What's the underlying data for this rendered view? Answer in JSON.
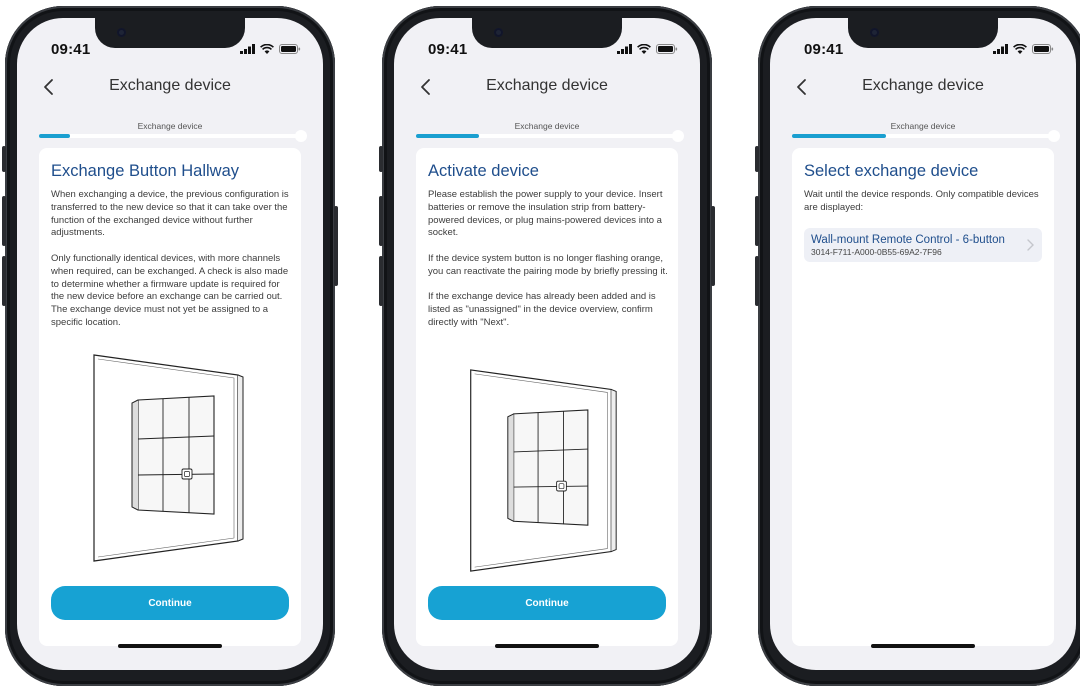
{
  "status": {
    "time": "09:41"
  },
  "header": {
    "title": "Exchange device",
    "step_label": "Exchange device"
  },
  "screens": [
    {
      "progress": 0.12,
      "title": "Exchange Button Hallway",
      "body": "When exchanging a device, the previous configuration is transferred to the new device so that it can take over the function of the exchanged device without further adjustments.\n\nOnly functionally identical devices, with more channels when required, can be exchanged. A check is also made to determine whether a firmware update is required for the new device before an exchange can be carried out. The exchange device must not yet be assigned to a specific location.",
      "button": "Continue"
    },
    {
      "progress": 0.24,
      "title": "Activate device",
      "body": "Please establish the power supply to your device. Insert batteries or remove the insulation strip from battery-powered devices, or plug mains-powered devices into a socket.\n\nIf the device system button is no longer flashing orange, you can reactivate the pairing mode by briefly pressing it.\n\nIf the exchange device has already been added and is listed as \"unassigned\" in the device overview, confirm directly with \"Next\".",
      "button": "Continue"
    },
    {
      "progress": 0.36,
      "title": "Select exchange device",
      "body": "Wait until the device responds. Only compatible devices are displayed:",
      "device": {
        "name": "Wall-mount Remote Control - 6-button",
        "id": "3014-F711-A000-0B55-69A2-7F96"
      }
    }
  ],
  "icons": {
    "back": "chevron-left-icon",
    "signal": "cellular-signal-icon",
    "wifi": "wifi-icon",
    "battery": "battery-icon",
    "device_chevron": "chevron-right-icon"
  },
  "colors": {
    "accent": "#17a2d3",
    "title": "#1f4e8c",
    "background": "#f1f1f5",
    "frame": "#1b1d21"
  }
}
